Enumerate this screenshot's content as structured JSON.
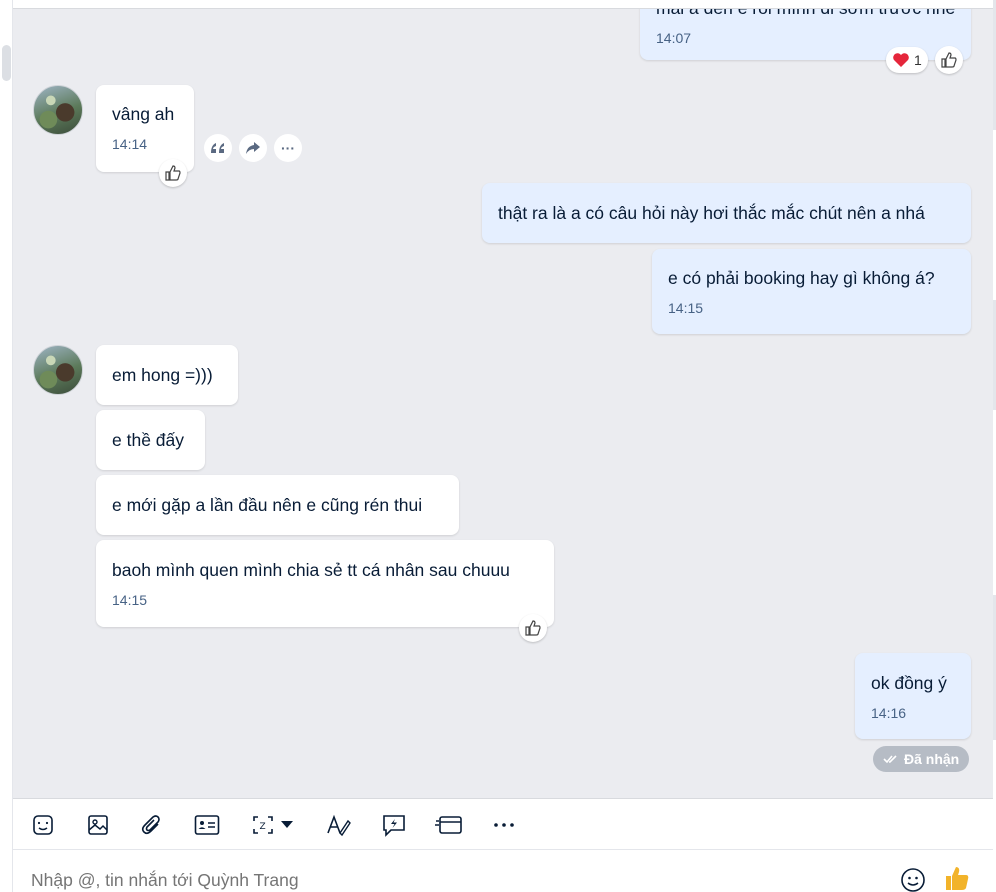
{
  "messages": {
    "m0": {
      "text": "mai a đến e rồi mình đi sớm trước nhé",
      "time": "14:07",
      "reaction_count": "1"
    },
    "m1": {
      "text": "vâng ah",
      "time": "14:14"
    },
    "m2": {
      "text": "thật ra là a có câu hỏi này hơi thắc mắc chút nên a nhá"
    },
    "m3": {
      "text": "e có phải booking hay gì không á?",
      "time": "14:15"
    },
    "m4": {
      "text": "em hong =)))"
    },
    "m5": {
      "text": "e thề đấy"
    },
    "m6": {
      "text": "e mới gặp a lần đầu nên e cũng rén thui"
    },
    "m7": {
      "text": "baoh mình quen mình chia sẻ tt cá nhân sau chuuu",
      "time": "14:15"
    },
    "m8": {
      "text": "ok đồng ý",
      "time": "14:16"
    }
  },
  "status": {
    "delivered": "Đã nhận"
  },
  "hover_actions": {
    "more": "···"
  },
  "composer": {
    "placeholder": "Nhập @, tin nhắn tới Quỳnh Trang"
  },
  "colors": {
    "outgoing_bubble": "#e5efff",
    "incoming_bubble": "#ffffff",
    "chat_bg": "#ebecf0",
    "heart": "#e5263b",
    "like_accent": "#f2b32a"
  },
  "icons": [
    "sticker-icon",
    "image-icon",
    "attach-icon",
    "contact-card-icon",
    "screenshot-icon",
    "dropdown-caret-icon",
    "format-text-icon",
    "quick-message-icon",
    "card-icon",
    "more-icon",
    "emoji-icon",
    "thumbs-up-icon",
    "quote-icon",
    "forward-icon",
    "heart-icon",
    "like-icon",
    "check-double-icon"
  ]
}
